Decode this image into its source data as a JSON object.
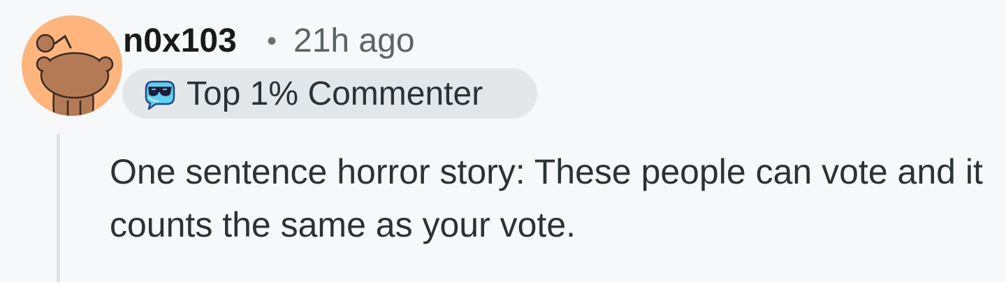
{
  "comment": {
    "username": "n0x103",
    "separator": "•",
    "timestamp": "21h ago",
    "flair": {
      "label": "Top 1% Commenter",
      "icon": "top-commenter-icon"
    },
    "body": "One sentence horror story: These people can vote and it counts the same as your vote.",
    "avatar": {
      "icon": "snoo-avatar-icon",
      "background_color": "#fdb57d",
      "figure_color": "#b47a56"
    }
  },
  "colors": {
    "page_background": "#f7f8fa",
    "flair_background": "#e4e7ea",
    "text_primary": "#2b3236",
    "text_secondary": "#5c6367",
    "thread_line": "#dfe2e5"
  }
}
